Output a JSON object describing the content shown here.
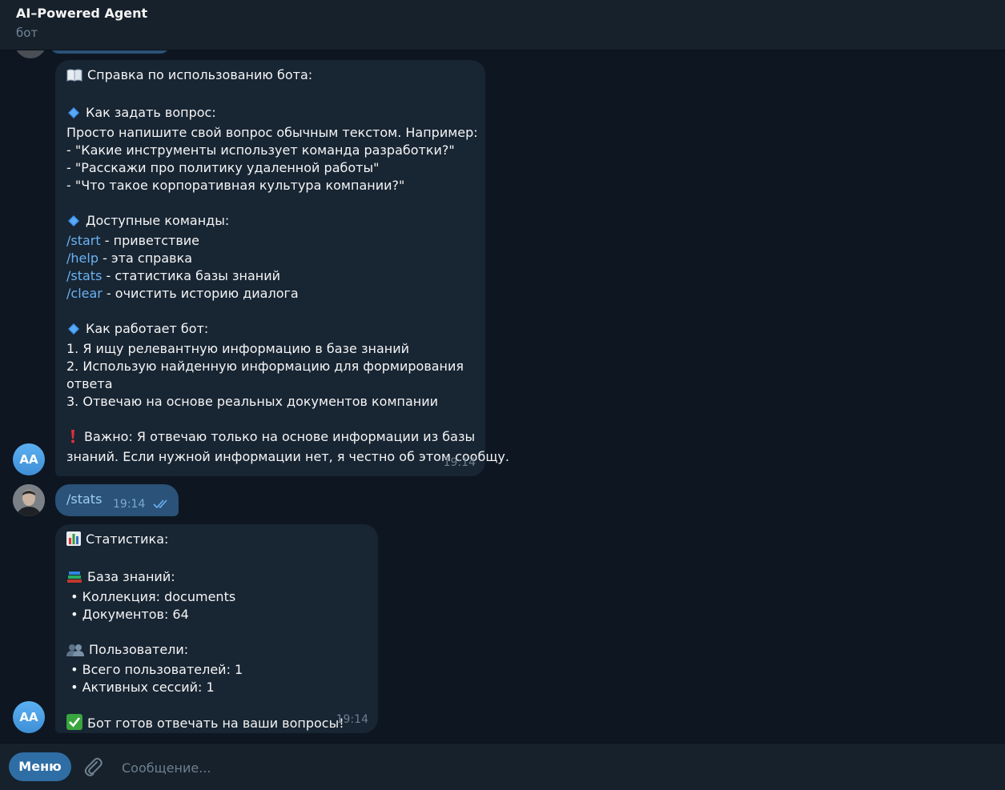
{
  "header": {
    "title": "AI–Powered Agent",
    "subtitle": "бот"
  },
  "messages": {
    "help": {
      "title": "Справка по использованию бота:",
      "section_ask": "Как задать вопрос:",
      "ask_intro": "Просто напишите свой вопрос обычным текстом. Например:",
      "examples": [
        "- \"Какие инструменты использует команда разработки?\"",
        "- \"Расскажи про политику удаленной работы\"",
        "- \"Что такое корпоративная культура компании?\""
      ],
      "section_commands": "Доступные команды:",
      "commands": [
        {
          "cmd": "/start",
          "desc": " - приветствие"
        },
        {
          "cmd": "/help",
          "desc": " - эта справка"
        },
        {
          "cmd": "/stats",
          "desc": " - статистика базы знаний"
        },
        {
          "cmd": "/clear",
          "desc": " - очистить историю диалога"
        }
      ],
      "section_how": "Как работает бот:",
      "steps": [
        "1. Я ищу релевантную информацию в базе знаний",
        "2. Использую найденную информацию для формирования",
        "ответа",
        "3. Отвечаю на основе реальных документов компании"
      ],
      "important_1": "Важно: Я отвечаю только на основе информации из базы",
      "important_2": "знаний. Если нужной информации нет, я честно об этом сообщу.",
      "time": "19:14"
    },
    "user_stats": {
      "text": "/stats",
      "time": "19:14"
    },
    "stats": {
      "title": "Статистика:",
      "kb_title": "База знаний:",
      "kb_items": [
        " • Коллекция: documents",
        " • Документов: 64"
      ],
      "users_title": "Пользователи:",
      "users_items": [
        " • Всего пользователей: 1",
        " • Активных сессий: 1"
      ],
      "ready": "Бот готов отвечать на ваши вопросы!",
      "time": "19:14"
    }
  },
  "avatars": {
    "bot_initials": "AA"
  },
  "composer": {
    "menu_label": "Меню",
    "placeholder": "Сообщение..."
  },
  "colors": {
    "accent": "#6ab3f3",
    "background": "#0e1621",
    "bubble_in": "#182533",
    "bubble_out": "#2b5278",
    "menu_button": "#2f6ea5"
  }
}
